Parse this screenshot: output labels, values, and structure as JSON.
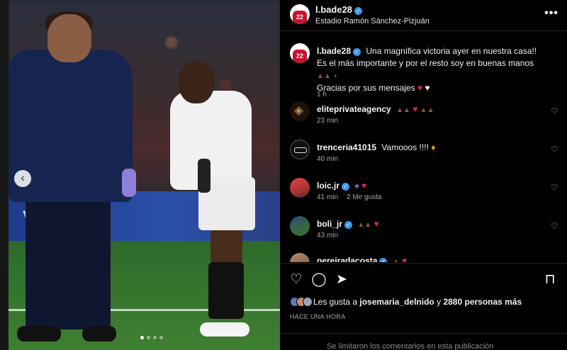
{
  "post": {
    "username": "l.bade28",
    "location": "Estadio Ramón Sánchez-Pizjuán",
    "avatar_number": "22",
    "more_icon": "more-horizontal-icon"
  },
  "photo": {
    "banner_text": "vsive",
    "carousel_dots": 4,
    "active_dot": 0
  },
  "caption": {
    "username": "l.bade28",
    "text": "Una magnífica victoria ayer en nuestra casa!! Es el más importante y por el resto soy en buenas manos",
    "text2": "Gracias por sus mensajes",
    "time": "1 h"
  },
  "comments": [
    {
      "username": "eliteprivateagency",
      "verified": false,
      "text": "",
      "time": "23 min",
      "likes": ""
    },
    {
      "username": "trenceria41015",
      "verified": false,
      "text": "Vamooos !!!!",
      "time": "40 min",
      "likes": ""
    },
    {
      "username": "loic.jr",
      "verified": true,
      "text": "",
      "time": "41 min",
      "likes": "2 Me gusta"
    },
    {
      "username": "boli_jr",
      "verified": true,
      "text": "",
      "time": "43 min",
      "likes": ""
    },
    {
      "username": "pereiradacosta",
      "verified": true,
      "text": "",
      "time": "",
      "likes": ""
    }
  ],
  "likes": {
    "prefix": "Les gusta a",
    "user": "josemaria_delnido",
    "joiner": "y",
    "others": "2880 personas más"
  },
  "time_ago": "HACE UNA HORA",
  "footer": "Se limitaron los comentarios en esta publicación",
  "colors": {
    "background": "#000000",
    "verified": "#3897f0",
    "heart": "#e0245e",
    "muted": "#a8a8a8"
  }
}
